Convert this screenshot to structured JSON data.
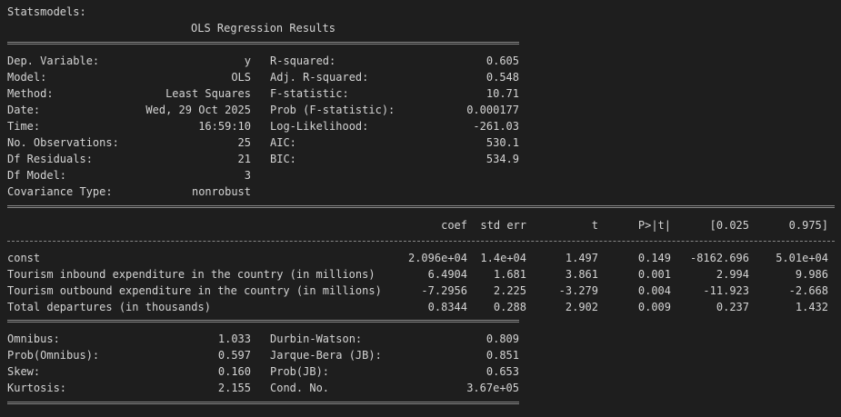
{
  "header": "Statsmodels:",
  "title": "OLS Regression Results",
  "top": {
    "left": [
      [
        "Dep. Variable:",
        "y"
      ],
      [
        "Model:",
        "OLS"
      ],
      [
        "Method:",
        "Least Squares"
      ],
      [
        "Date:",
        "Wed, 29 Oct 2025"
      ],
      [
        "Time:",
        "16:59:10"
      ],
      [
        "No. Observations:",
        "25"
      ],
      [
        "Df Residuals:",
        "21"
      ],
      [
        "Df Model:",
        "3"
      ],
      [
        "Covariance Type:",
        "nonrobust"
      ]
    ],
    "right": [
      [
        "R-squared:",
        "0.605"
      ],
      [
        "Adj. R-squared:",
        "0.548"
      ],
      [
        "F-statistic:",
        "10.71"
      ],
      [
        "Prob (F-statistic):",
        "0.000177"
      ],
      [
        "Log-Likelihood:",
        "-261.03"
      ],
      [
        "AIC:",
        "530.1"
      ],
      [
        "BIC:",
        "534.9"
      ]
    ]
  },
  "coef_table": {
    "headers": [
      "coef",
      "std err",
      "t",
      "P>|t|",
      "[0.025",
      "0.975]"
    ],
    "rows": [
      [
        "const",
        "2.096e+04",
        "1.4e+04",
        "1.497",
        "0.149",
        "-8162.696",
        "5.01e+04"
      ],
      [
        "Tourism inbound expenditure in the country (in millions)",
        "6.4904",
        "1.681",
        "3.861",
        "0.001",
        "2.994",
        "9.986"
      ],
      [
        "Tourism outbound expenditure in the country (in millions)",
        "-7.2956",
        "2.225",
        "-3.279",
        "0.004",
        "-11.923",
        "-2.668"
      ],
      [
        "Total departures (in thousands)",
        "0.8344",
        "0.288",
        "2.902",
        "0.009",
        "0.237",
        "1.432"
      ]
    ]
  },
  "bottom": {
    "left": [
      [
        "Omnibus:",
        "1.033"
      ],
      [
        "Prob(Omnibus):",
        "0.597"
      ],
      [
        "Skew:",
        "0.160"
      ],
      [
        "Kurtosis:",
        "2.155"
      ]
    ],
    "right": [
      [
        "Durbin-Watson:",
        "0.809"
      ],
      [
        "Jarque-Bera (JB):",
        "0.851"
      ],
      [
        "Prob(JB):",
        "0.653"
      ],
      [
        "Cond. No.",
        "3.67e+05"
      ]
    ]
  }
}
